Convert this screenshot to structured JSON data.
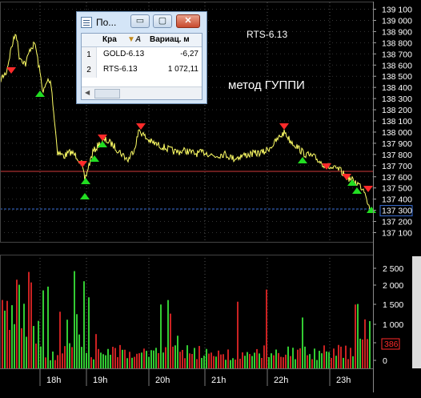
{
  "chart": {
    "instrument_label": "RTS-6.13",
    "method_label": "метод ГУППИ",
    "price_axis_labels": [
      "139 100",
      "139 000",
      "138 900",
      "138 800",
      "138 700",
      "138 600",
      "138 500",
      "138 400",
      "138 300",
      "138 200",
      "138 100",
      "138 000",
      "137 900",
      "137 800",
      "137 700",
      "137 600",
      "137 500",
      "137 400",
      "137 300",
      "137 200",
      "137 100"
    ],
    "current_price": "137 300",
    "volume_axis_labels": [
      "2 500",
      "2 000",
      "1 500",
      "1 000",
      "500",
      "0"
    ],
    "current_volume": "386",
    "time_axis_labels": [
      "18h",
      "19h",
      "20h",
      "21h",
      "22h",
      "23h"
    ],
    "colors": {
      "background": "#000000",
      "price_line": "#ffff66",
      "grid": "#555555",
      "red_level": "#d23a3a",
      "blue_level": "#3a6fd8",
      "volume_up": "#33cc33",
      "volume_down": "#cc2222",
      "signal_sell": "#ff2a2a",
      "signal_buy": "#22dd22"
    }
  },
  "window": {
    "title": "По...",
    "minimize_label": "▭",
    "maximize_label": "▢",
    "close_label": "✕",
    "columns": [
      "Кра",
      "Вариац. м"
    ],
    "rows": [
      {
        "num": "1",
        "name": "GOLD-6.13",
        "value": "-6,27"
      },
      {
        "num": "2",
        "name": "RTS-6.13",
        "value": "1 072,11"
      }
    ]
  }
}
